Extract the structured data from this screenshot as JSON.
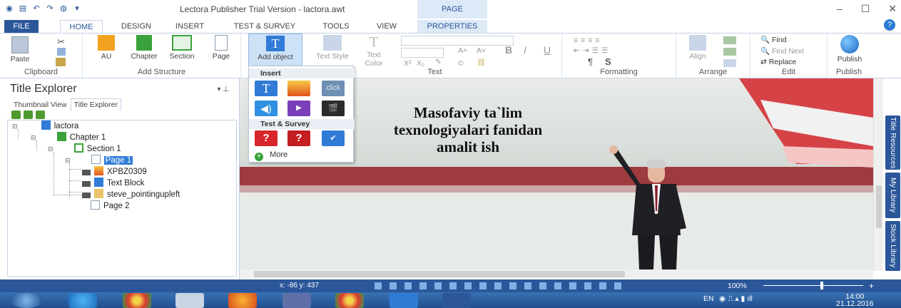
{
  "window": {
    "title": "Lectora Publisher Trial Version - lactora.awt",
    "context_tab_group": "PAGE"
  },
  "tabs": [
    "FILE",
    "HOME",
    "DESIGN",
    "INSERT",
    "TEST & SURVEY",
    "TOOLS",
    "VIEW",
    "PROPERTIES"
  ],
  "ribbon": {
    "clipboard": {
      "label": "Clipboard",
      "paste": "Paste"
    },
    "add_structure": {
      "label": "Add Structure",
      "au": "AU",
      "chapter": "Chapter",
      "section": "Section",
      "page": "Page"
    },
    "add_object": "Add object",
    "text_group": {
      "label": "Text",
      "text_style": "Text Style",
      "text_color_1": "Text",
      "text_color_2": "Color"
    },
    "formatting": {
      "label": "Formatting"
    },
    "arrange": {
      "label": "Arrange",
      "align": "Align"
    },
    "edit": {
      "label": "Edit",
      "find": "Find",
      "find_next": "Find Next",
      "replace": "Replace"
    },
    "publish": {
      "label": "Publish",
      "button": "Publish"
    }
  },
  "insert_menu": {
    "header": "Insert",
    "test_header": "Test & Survey",
    "more": "More",
    "click_button_text": "click"
  },
  "explorer": {
    "title": "Title Explorer",
    "tab_thumbnail": "Thumbnail View",
    "tab_title": "Title Explorer",
    "tree": {
      "root": "lactora",
      "chapter": "Chapter 1",
      "section": "Section 1",
      "page1": "Page 1",
      "obj_image": "XPBZ0309",
      "obj_text": "Text Block",
      "obj_person": "steve_pointingupleft",
      "page2": "Page 2"
    }
  },
  "stage": {
    "line1": "Masofaviy ta`lim",
    "line2": "texnologiyalari fanidan",
    "line3": "amalit ish"
  },
  "side_tabs": [
    "Title Resources",
    "My Library",
    "Stock Library"
  ],
  "status": {
    "coords": "x: -86  y: 437",
    "zoom": "100%"
  },
  "taskbar": {
    "lang": "EN",
    "time": "14:00",
    "date": "21.12.2016"
  },
  "colors": {
    "accent": "#2b579a",
    "selection": "#2f7bd6"
  }
}
